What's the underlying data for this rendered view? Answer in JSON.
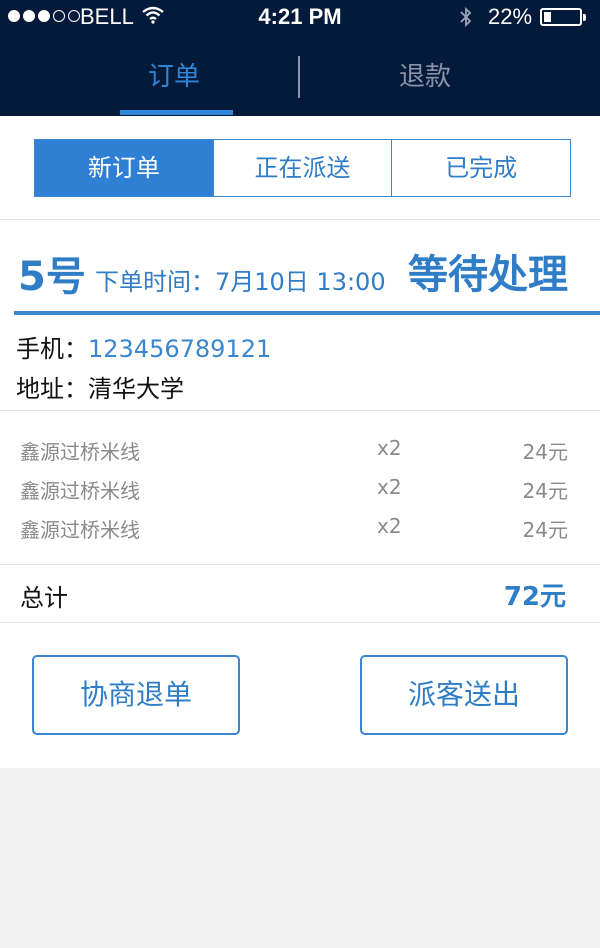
{
  "status_bar": {
    "carrier": "BELL",
    "time": "4:21 PM",
    "battery": "22%",
    "battery_level": 0.22,
    "signal_bars_filled": 3,
    "signal_bars_total": 5
  },
  "top_tabs": {
    "orders": "订单",
    "refund": "退款"
  },
  "segments": [
    "新订单",
    "正在派送",
    "已完成"
  ],
  "order": {
    "number": "5号",
    "time": "下单时间：7月10日 13:00",
    "status": "等待处理",
    "phone_label": "手机：",
    "phone": "123456789121",
    "address_label": "地址：",
    "address": "清华大学"
  },
  "items": [
    {
      "name": "鑫源过桥米线",
      "qty": "x2",
      "price": "24元"
    },
    {
      "name": "鑫源过桥米线",
      "qty": "x2",
      "price": "24元"
    },
    {
      "name": "鑫源过桥米线",
      "qty": "x2",
      "price": "24元"
    }
  ],
  "total": {
    "label": "总计",
    "value": "72元"
  },
  "actions": {
    "negotiate": "协商退单",
    "dispatch": "派客送出"
  },
  "colors": {
    "header_bg": "#041a3a",
    "accent": "#2f7dc6",
    "active_segment": "#2f7fd4",
    "page_bg": "#f0f0f0"
  }
}
